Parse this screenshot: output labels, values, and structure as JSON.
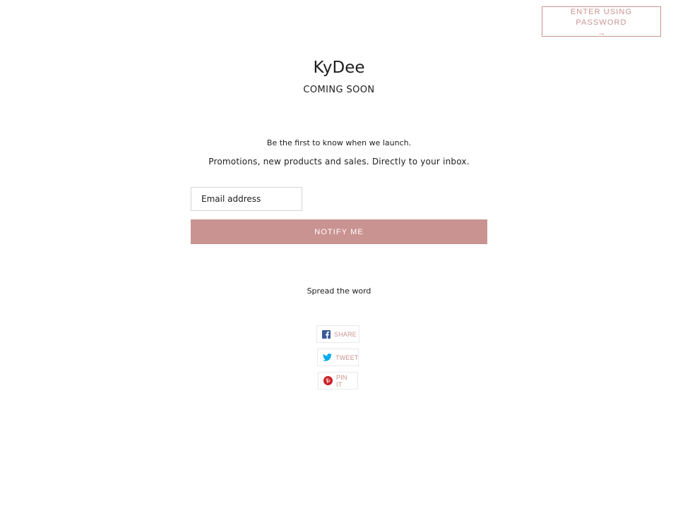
{
  "header": {
    "password_button_label": "ENTER USING PASSWORD",
    "password_button_arrow": "→"
  },
  "brand": {
    "name": "KyDee",
    "tagline": "COMING SOON"
  },
  "signup": {
    "intro": "Be the first to know when we launch.",
    "promo": "Promotions, new products and sales. Directly to your inbox.",
    "email_placeholder": "Email address",
    "email_value": "",
    "submit_label": "NOTIFY ME"
  },
  "social": {
    "heading": "Spread the word",
    "buttons": [
      {
        "label": "SHARE",
        "icon": "facebook-icon"
      },
      {
        "label": "TWEET",
        "icon": "twitter-icon"
      },
      {
        "label": "PIN IT",
        "icon": "pinterest-icon"
      }
    ]
  },
  "colors": {
    "accent": "#c99391",
    "text": "#1c1d1d",
    "border": "#e8e9eb",
    "facebook": "#3b5998",
    "twitter": "#00aced",
    "pinterest": "#cb2027"
  }
}
